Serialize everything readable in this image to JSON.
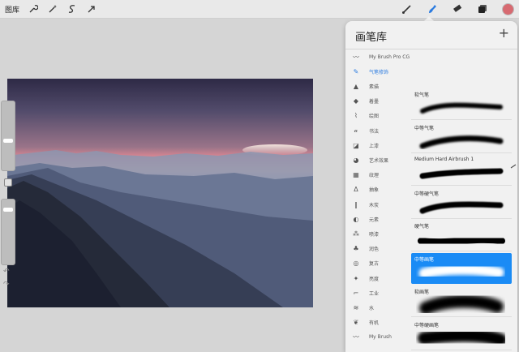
{
  "toolbar": {
    "gallery_label": "图库",
    "colors": {
      "accent": "#2b7be0",
      "current_color": "#d76a71"
    }
  },
  "brush_library": {
    "title": "画笔库",
    "add_symbol": "+",
    "sets": [
      {
        "label": "My Brush Pro CG",
        "icon": "brush-stroke-icon"
      },
      {
        "label": "气笔修饰",
        "icon": "airbrush-icon",
        "active": true
      },
      {
        "label": "素描",
        "icon": "pencil-icon"
      },
      {
        "label": "着墨",
        "icon": "ink-drop-icon"
      },
      {
        "label": "绘图",
        "icon": "drawing-icon"
      },
      {
        "label": "书法",
        "icon": "calligraphy-icon"
      },
      {
        "label": "上漆",
        "icon": "paint-icon"
      },
      {
        "label": "艺术效果",
        "icon": "palette-icon"
      },
      {
        "label": "纹理",
        "icon": "texture-icon"
      },
      {
        "label": "抽象",
        "icon": "abstract-icon"
      },
      {
        "label": "木炭",
        "icon": "charcoal-icon"
      },
      {
        "label": "元素",
        "icon": "elements-icon"
      },
      {
        "label": "喷漆",
        "icon": "spray-icon"
      },
      {
        "label": "润色",
        "icon": "touchup-icon"
      },
      {
        "label": "复古",
        "icon": "retro-icon"
      },
      {
        "label": "亮度",
        "icon": "luminance-icon"
      },
      {
        "label": "工业",
        "icon": "industrial-icon"
      },
      {
        "label": "水",
        "icon": "water-icon"
      },
      {
        "label": "有机",
        "icon": "organic-icon"
      },
      {
        "label": "My Brush",
        "icon": "brush-stroke-icon"
      }
    ],
    "brushes": [
      {
        "name": "软气笔",
        "selected": false
      },
      {
        "name": "中等气笔",
        "selected": false
      },
      {
        "name": "Medium Hard Airbrush 1",
        "selected": false,
        "badge": "brush-indicator-icon"
      },
      {
        "name": "中等硬气笔",
        "selected": false
      },
      {
        "name": "硬气笔",
        "selected": false
      },
      {
        "name": "中等画笔",
        "selected": true
      },
      {
        "name": "软画笔",
        "selected": false
      },
      {
        "name": "中等硬画笔",
        "selected": false
      }
    ]
  }
}
